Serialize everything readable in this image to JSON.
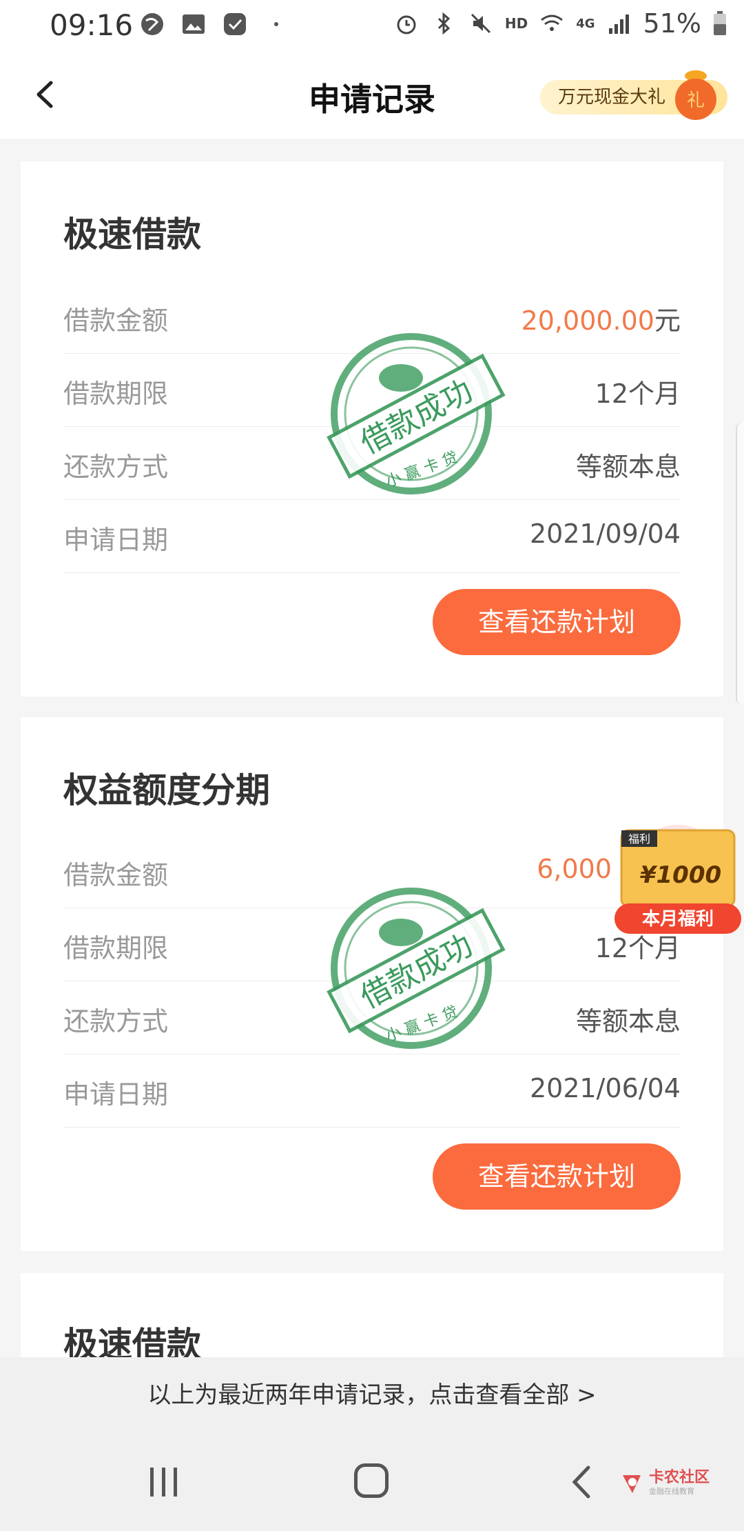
{
  "status_bar": {
    "time": "09:16",
    "network": "4G",
    "hd": "HD",
    "battery": "51%"
  },
  "header": {
    "title": "申请记录",
    "promo_label": "万元现金大礼",
    "promo_icon_text": "礼"
  },
  "cards": [
    {
      "title": "极速借款",
      "rows": [
        {
          "label": "借款金额",
          "value_amount": "20,000.00",
          "value_unit": "元"
        },
        {
          "label": "借款期限",
          "value": "12个月"
        },
        {
          "label": "还款方式",
          "value": "等额本息"
        },
        {
          "label": "申请日期",
          "value": "2021/09/04"
        }
      ],
      "stamp": {
        "text": "借款成功",
        "sub": "小 赢 卡 贷"
      },
      "button": "查看还款计划"
    },
    {
      "title": "权益额度分期",
      "rows": [
        {
          "label": "借款金额",
          "value_amount": "6,000",
          "value_unit": ""
        },
        {
          "label": "借款期限",
          "value": "12个月"
        },
        {
          "label": "还款方式",
          "value": "等额本息"
        },
        {
          "label": "申请日期",
          "value": "2021/06/04"
        }
      ],
      "stamp": {
        "text": "借款成功",
        "sub": "小 赢 卡 贷"
      },
      "button": "查看还款计划"
    },
    {
      "title": "极速借款"
    }
  ],
  "welfare_badge": {
    "tag": "福利",
    "amount": "¥1000",
    "label": "本月福利"
  },
  "footer": {
    "note": "以上为最近两年申请记录，点击查看全部 >"
  },
  "watermark": {
    "name": "卡农社区",
    "sub": "金融在线教育"
  },
  "colors": {
    "accent": "#fb6b3d",
    "amount": "#f07a4a",
    "stamp": "#3a9a5c"
  }
}
